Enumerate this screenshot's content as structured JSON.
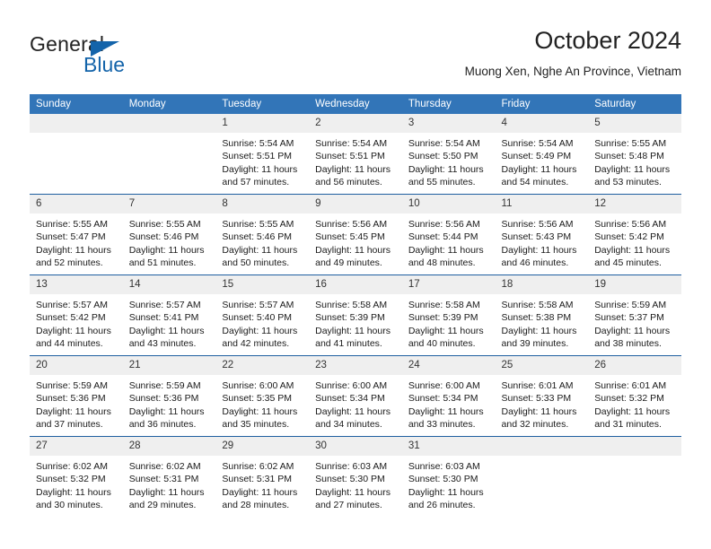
{
  "brand": {
    "name_top": "General",
    "name_bottom": "Blue",
    "triangle_icon": "triangle-icon",
    "accent_color": "#1464aa"
  },
  "header": {
    "title": "October 2024",
    "subtitle": "Muong Xen, Nghe An Province, Vietnam"
  },
  "theme": {
    "header_blue": "#3275b8",
    "row_separator": "#1f5fa0",
    "daynum_band": "#efefef",
    "text": "#1a1a1a"
  },
  "calendar": {
    "weekday_headers": [
      "Sunday",
      "Monday",
      "Tuesday",
      "Wednesday",
      "Thursday",
      "Friday",
      "Saturday"
    ],
    "weeks": [
      [
        {
          "day": "",
          "blank": true
        },
        {
          "day": "",
          "blank": true
        },
        {
          "day": "1",
          "sunrise": "Sunrise: 5:54 AM",
          "sunset": "Sunset: 5:51 PM",
          "daylight": "Daylight: 11 hours and 57 minutes."
        },
        {
          "day": "2",
          "sunrise": "Sunrise: 5:54 AM",
          "sunset": "Sunset: 5:51 PM",
          "daylight": "Daylight: 11 hours and 56 minutes."
        },
        {
          "day": "3",
          "sunrise": "Sunrise: 5:54 AM",
          "sunset": "Sunset: 5:50 PM",
          "daylight": "Daylight: 11 hours and 55 minutes."
        },
        {
          "day": "4",
          "sunrise": "Sunrise: 5:54 AM",
          "sunset": "Sunset: 5:49 PM",
          "daylight": "Daylight: 11 hours and 54 minutes."
        },
        {
          "day": "5",
          "sunrise": "Sunrise: 5:55 AM",
          "sunset": "Sunset: 5:48 PM",
          "daylight": "Daylight: 11 hours and 53 minutes."
        }
      ],
      [
        {
          "day": "6",
          "sunrise": "Sunrise: 5:55 AM",
          "sunset": "Sunset: 5:47 PM",
          "daylight": "Daylight: 11 hours and 52 minutes."
        },
        {
          "day": "7",
          "sunrise": "Sunrise: 5:55 AM",
          "sunset": "Sunset: 5:46 PM",
          "daylight": "Daylight: 11 hours and 51 minutes."
        },
        {
          "day": "8",
          "sunrise": "Sunrise: 5:55 AM",
          "sunset": "Sunset: 5:46 PM",
          "daylight": "Daylight: 11 hours and 50 minutes."
        },
        {
          "day": "9",
          "sunrise": "Sunrise: 5:56 AM",
          "sunset": "Sunset: 5:45 PM",
          "daylight": "Daylight: 11 hours and 49 minutes."
        },
        {
          "day": "10",
          "sunrise": "Sunrise: 5:56 AM",
          "sunset": "Sunset: 5:44 PM",
          "daylight": "Daylight: 11 hours and 48 minutes."
        },
        {
          "day": "11",
          "sunrise": "Sunrise: 5:56 AM",
          "sunset": "Sunset: 5:43 PM",
          "daylight": "Daylight: 11 hours and 46 minutes."
        },
        {
          "day": "12",
          "sunrise": "Sunrise: 5:56 AM",
          "sunset": "Sunset: 5:42 PM",
          "daylight": "Daylight: 11 hours and 45 minutes."
        }
      ],
      [
        {
          "day": "13",
          "sunrise": "Sunrise: 5:57 AM",
          "sunset": "Sunset: 5:42 PM",
          "daylight": "Daylight: 11 hours and 44 minutes."
        },
        {
          "day": "14",
          "sunrise": "Sunrise: 5:57 AM",
          "sunset": "Sunset: 5:41 PM",
          "daylight": "Daylight: 11 hours and 43 minutes."
        },
        {
          "day": "15",
          "sunrise": "Sunrise: 5:57 AM",
          "sunset": "Sunset: 5:40 PM",
          "daylight": "Daylight: 11 hours and 42 minutes."
        },
        {
          "day": "16",
          "sunrise": "Sunrise: 5:58 AM",
          "sunset": "Sunset: 5:39 PM",
          "daylight": "Daylight: 11 hours and 41 minutes."
        },
        {
          "day": "17",
          "sunrise": "Sunrise: 5:58 AM",
          "sunset": "Sunset: 5:39 PM",
          "daylight": "Daylight: 11 hours and 40 minutes."
        },
        {
          "day": "18",
          "sunrise": "Sunrise: 5:58 AM",
          "sunset": "Sunset: 5:38 PM",
          "daylight": "Daylight: 11 hours and 39 minutes."
        },
        {
          "day": "19",
          "sunrise": "Sunrise: 5:59 AM",
          "sunset": "Sunset: 5:37 PM",
          "daylight": "Daylight: 11 hours and 38 minutes."
        }
      ],
      [
        {
          "day": "20",
          "sunrise": "Sunrise: 5:59 AM",
          "sunset": "Sunset: 5:36 PM",
          "daylight": "Daylight: 11 hours and 37 minutes."
        },
        {
          "day": "21",
          "sunrise": "Sunrise: 5:59 AM",
          "sunset": "Sunset: 5:36 PM",
          "daylight": "Daylight: 11 hours and 36 minutes."
        },
        {
          "day": "22",
          "sunrise": "Sunrise: 6:00 AM",
          "sunset": "Sunset: 5:35 PM",
          "daylight": "Daylight: 11 hours and 35 minutes."
        },
        {
          "day": "23",
          "sunrise": "Sunrise: 6:00 AM",
          "sunset": "Sunset: 5:34 PM",
          "daylight": "Daylight: 11 hours and 34 minutes."
        },
        {
          "day": "24",
          "sunrise": "Sunrise: 6:00 AM",
          "sunset": "Sunset: 5:34 PM",
          "daylight": "Daylight: 11 hours and 33 minutes."
        },
        {
          "day": "25",
          "sunrise": "Sunrise: 6:01 AM",
          "sunset": "Sunset: 5:33 PM",
          "daylight": "Daylight: 11 hours and 32 minutes."
        },
        {
          "day": "26",
          "sunrise": "Sunrise: 6:01 AM",
          "sunset": "Sunset: 5:32 PM",
          "daylight": "Daylight: 11 hours and 31 minutes."
        }
      ],
      [
        {
          "day": "27",
          "sunrise": "Sunrise: 6:02 AM",
          "sunset": "Sunset: 5:32 PM",
          "daylight": "Daylight: 11 hours and 30 minutes."
        },
        {
          "day": "28",
          "sunrise": "Sunrise: 6:02 AM",
          "sunset": "Sunset: 5:31 PM",
          "daylight": "Daylight: 11 hours and 29 minutes."
        },
        {
          "day": "29",
          "sunrise": "Sunrise: 6:02 AM",
          "sunset": "Sunset: 5:31 PM",
          "daylight": "Daylight: 11 hours and 28 minutes."
        },
        {
          "day": "30",
          "sunrise": "Sunrise: 6:03 AM",
          "sunset": "Sunset: 5:30 PM",
          "daylight": "Daylight: 11 hours and 27 minutes."
        },
        {
          "day": "31",
          "sunrise": "Sunrise: 6:03 AM",
          "sunset": "Sunset: 5:30 PM",
          "daylight": "Daylight: 11 hours and 26 minutes."
        },
        {
          "day": "",
          "blank": true
        },
        {
          "day": "",
          "blank": true
        }
      ]
    ]
  }
}
